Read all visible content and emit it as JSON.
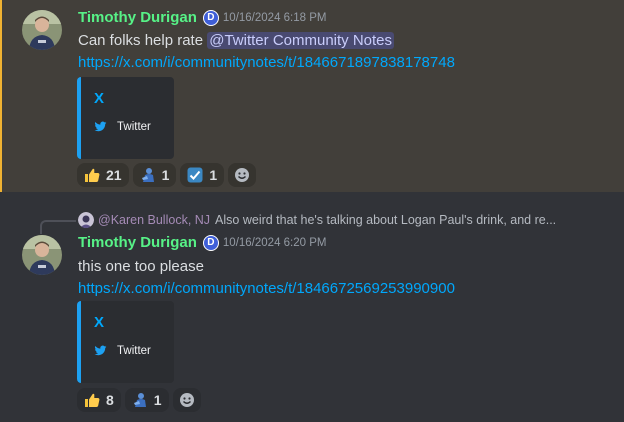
{
  "messages": [
    {
      "username": "Timothy Durigan",
      "badge_letter": "D",
      "timestamp": "10/16/2024 6:18 PM",
      "text": "Can folks help rate ",
      "mention": "@Twitter Community Notes",
      "link": "https://x.com/i/communitynotes/t/1846671897838178748",
      "embed": {
        "title": "X",
        "provider": "Twitter"
      },
      "reactions": [
        {
          "emoji": "thumbs-up-icon",
          "count": "21"
        },
        {
          "emoji": "person-icon",
          "count": "1"
        },
        {
          "emoji": "check-box-icon",
          "count": "1"
        }
      ]
    },
    {
      "reply": {
        "author": "@Karen Bullock, NJ",
        "text": "Also weird that he's talking about Logan Paul's drink, and re..."
      },
      "username": "Timothy Durigan",
      "badge_letter": "D",
      "timestamp": "10/16/2024 6:20 PM",
      "text": "this one too please",
      "link": "https://x.com/i/communitynotes/t/1846672569253990900",
      "embed": {
        "title": "X",
        "provider": "Twitter"
      },
      "reactions": [
        {
          "emoji": "thumbs-up-icon",
          "count": "8"
        },
        {
          "emoji": "person-icon",
          "count": "1"
        }
      ]
    }
  ],
  "colors": {
    "highlight_bg": "#423f3a",
    "highlight_bar": "#f0b232",
    "username": "#57f287",
    "link": "#00a8fc",
    "mention": "#c9cdfb",
    "embed_border": "#1da1f2"
  }
}
